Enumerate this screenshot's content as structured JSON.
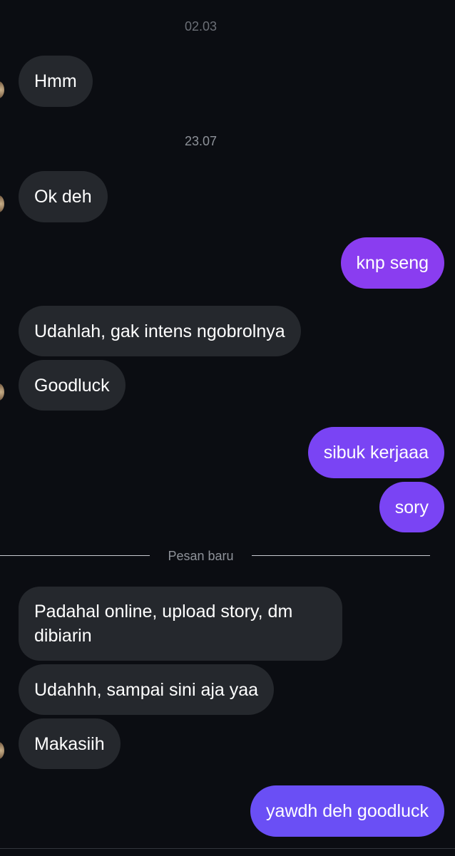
{
  "timestamps": {
    "first": "02.03",
    "second": "23.07"
  },
  "messages": {
    "m1": "Hmm",
    "m2": "Ok deh",
    "m3": "knp seng",
    "m4": "Udahlah, gak intens ngobrolnya",
    "m5": "Goodluck",
    "m6": "sibuk kerjaaa",
    "m7": "sory",
    "m8": "Padahal online, upload story, dm dibiarin",
    "m9": "Udahhh, sampai sini aja yaa",
    "m10": "Makasiih",
    "m11": "yawdh deh goodluck"
  },
  "divider": {
    "label": "Pesan baru"
  },
  "colors": {
    "background": "#0b0d12",
    "incoming_bubble": "#25282d",
    "outgoing_bubble_top": "#8a3df0",
    "outgoing_bubble_bottom": "#6a4ff5",
    "timestamp_text": "#8e9299"
  },
  "icons": {
    "avatar": "contact-avatar"
  }
}
